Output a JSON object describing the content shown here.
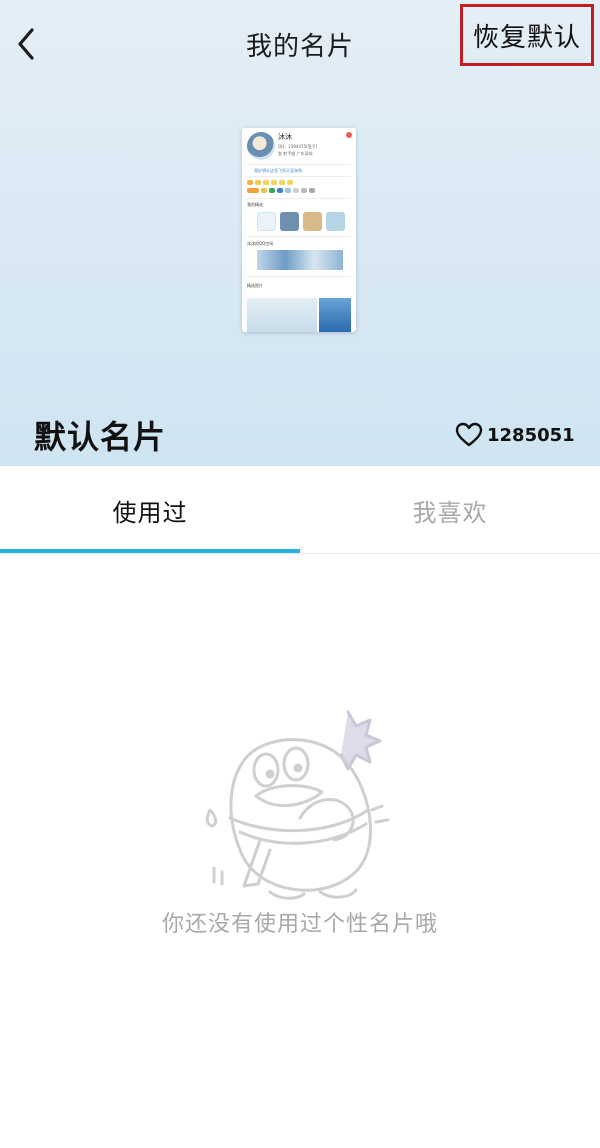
{
  "header": {
    "title": "我的名片",
    "back_icon": "chevron-left-icon",
    "restore_label": "恢复默认"
  },
  "card": {
    "preview_name": "沐沐",
    "preview_qq": "QQ：2394475(签子)",
    "preview_location": "女  射手座  广东深圳",
    "preview_sign": "我好想从这里飞到天涯海角",
    "section_photos": "我的精选",
    "section_space": "沐沐的QQ空间",
    "section_featured": "精选照片",
    "name": "默认名片",
    "like_icon": "heart-outline-icon",
    "like_count": "1285051"
  },
  "tabs": [
    {
      "label": "使用过",
      "active": true
    },
    {
      "label": "我喜欢",
      "active": false
    }
  ],
  "empty": {
    "illustration": "qq-penguin-shy-illustration",
    "message": "你还没有使用过个性名片哦"
  },
  "colors": {
    "accent": "#27b2e3",
    "highlight_border": "#c01e22",
    "muted_text": "#a8a8a8"
  }
}
